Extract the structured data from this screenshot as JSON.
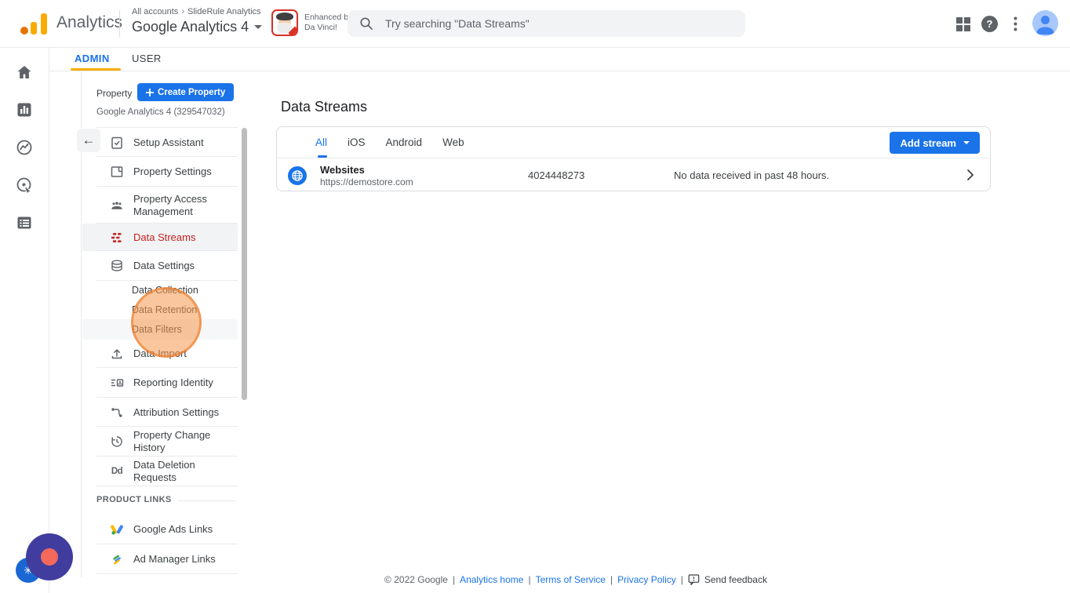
{
  "colors": {
    "accent_blue": "#1a73e8",
    "selected_red": "#c5221f",
    "tab_underline_orange": "#f9ab00",
    "logo_orange": "#f9ab00",
    "logo_dot_orange": "#e37400",
    "highlight_circle_orange": "#f69848"
  },
  "header": {
    "brand": "Analytics",
    "breadcrumb": {
      "root": "All accounts",
      "separator": "›",
      "account": "SlideRule Analytics"
    },
    "property_selector": "Google Analytics 4",
    "enhanced_badge": {
      "line1": "Enhanced by",
      "line2": "Da Vinci!"
    },
    "search": {
      "placeholder": "Try searching \"Data Streams\""
    },
    "help_glyph": "?"
  },
  "nav_tabs": {
    "admin": "ADMIN",
    "user": "USER"
  },
  "property_panel": {
    "label": "Property",
    "create_button": "Create Property",
    "property_name": "Google Analytics 4 (329547032)",
    "back_glyph": "←",
    "items": [
      {
        "label": "Setup Assistant",
        "icon": "setup-assistant-icon"
      },
      {
        "label": "Property Settings",
        "icon": "property-settings-icon"
      },
      {
        "label": "Property Access Management",
        "icon": "people-icon"
      },
      {
        "label": "Data Streams",
        "icon": "data-streams-icon",
        "selected": true
      },
      {
        "label": "Data Settings",
        "icon": "database-icon"
      },
      {
        "label": "Data Import",
        "icon": "upload-icon"
      },
      {
        "label": "Reporting Identity",
        "icon": "identity-icon"
      },
      {
        "label": "Attribution Settings",
        "icon": "route-icon"
      },
      {
        "label": "Property Change History",
        "icon": "history-icon"
      },
      {
        "label": "Data Deletion Requests",
        "icon": "dd-icon"
      },
      {
        "label": "Google Ads Links",
        "icon": "google-ads-icon"
      },
      {
        "label": "Ad Manager Links",
        "icon": "ad-manager-icon"
      }
    ],
    "sub_items": [
      "Data Collection",
      "Data Retention",
      "Data Filters"
    ],
    "section_header": "PRODUCT LINKS",
    "dd_glyph": "Dd"
  },
  "main": {
    "title": "Data Streams",
    "stream_tabs": [
      "All",
      "iOS",
      "Android",
      "Web"
    ],
    "add_stream_button": "Add stream",
    "streams": [
      {
        "name": "Websites",
        "url": "https://demostore.com",
        "stream_id": "4024448273",
        "status": "No data received in past 48 hours."
      }
    ]
  },
  "footer": {
    "copyright": "© 2022 Google",
    "separator": "|",
    "links": [
      "Analytics home",
      "Terms of Service",
      "Privacy Policy"
    ],
    "feedback": "Send feedback"
  }
}
